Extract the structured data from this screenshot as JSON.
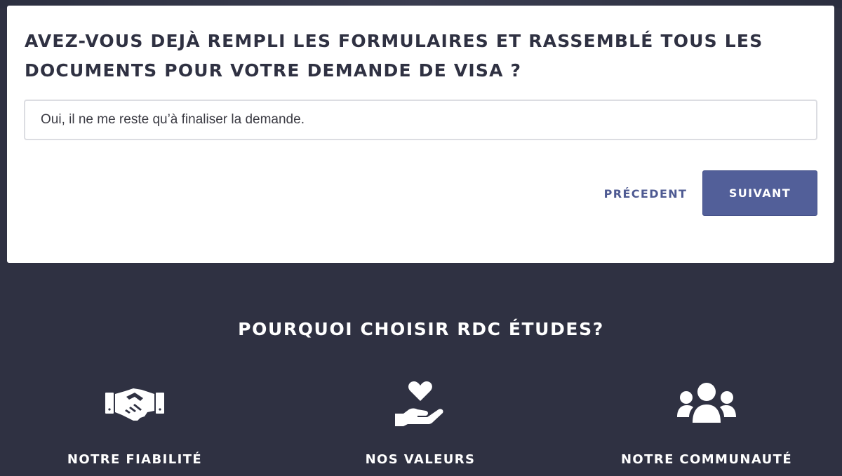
{
  "quiz": {
    "question": "AVEZ-VOUS DEJÀ REMPLI LES FORMULAIRES ET RASSEMBLÉ TOUS LES DOCUMENTS POUR VOTRE DEMANDE DE VISA ?",
    "answer": "Oui, il ne me reste qu’à finaliser la demande.",
    "prev_label": "PRÉCEDENT",
    "next_label": "SUIVANT"
  },
  "why": {
    "title": "POURQUOI CHOISIR RDC ÉTUDES?",
    "features": [
      {
        "icon": "handshake-icon",
        "label": "NOTRE FIABILITÉ"
      },
      {
        "icon": "heart-hand-icon",
        "label": "NOS VALEURS"
      },
      {
        "icon": "users-icon",
        "label": "NOTRE COMMUNAUTÉ"
      }
    ]
  },
  "colors": {
    "background": "#2f3142",
    "card": "#ffffff",
    "accent": "#525f99",
    "heading": "#2f3142"
  }
}
